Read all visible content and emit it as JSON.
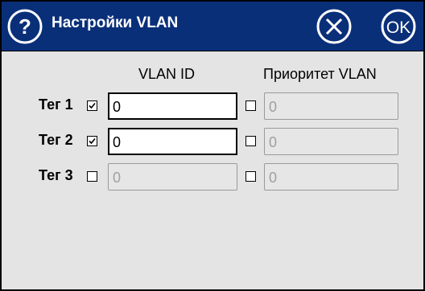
{
  "window": {
    "title": "Настройки VLAN"
  },
  "header": {
    "vlan_id_label": "VLAN ID",
    "priority_label": "Приоритет VLAN"
  },
  "rows": [
    {
      "label": "Тег 1",
      "tag_checked": true,
      "vlan_id": "0",
      "vlan_id_enabled": true,
      "priority_checked": false,
      "priority": "0",
      "priority_enabled": false
    },
    {
      "label": "Тег 2",
      "tag_checked": true,
      "vlan_id": "0",
      "vlan_id_enabled": true,
      "priority_checked": false,
      "priority": "0",
      "priority_enabled": false
    },
    {
      "label": "Тег 3",
      "tag_checked": false,
      "vlan_id": "0",
      "vlan_id_enabled": false,
      "priority_checked": false,
      "priority": "0",
      "priority_enabled": false
    }
  ],
  "icons": {
    "help": "help-icon",
    "close": "close-icon",
    "ok": "ok-icon"
  },
  "colors": {
    "titlebar": "#0a2f79",
    "background": "#e4e4e4"
  }
}
